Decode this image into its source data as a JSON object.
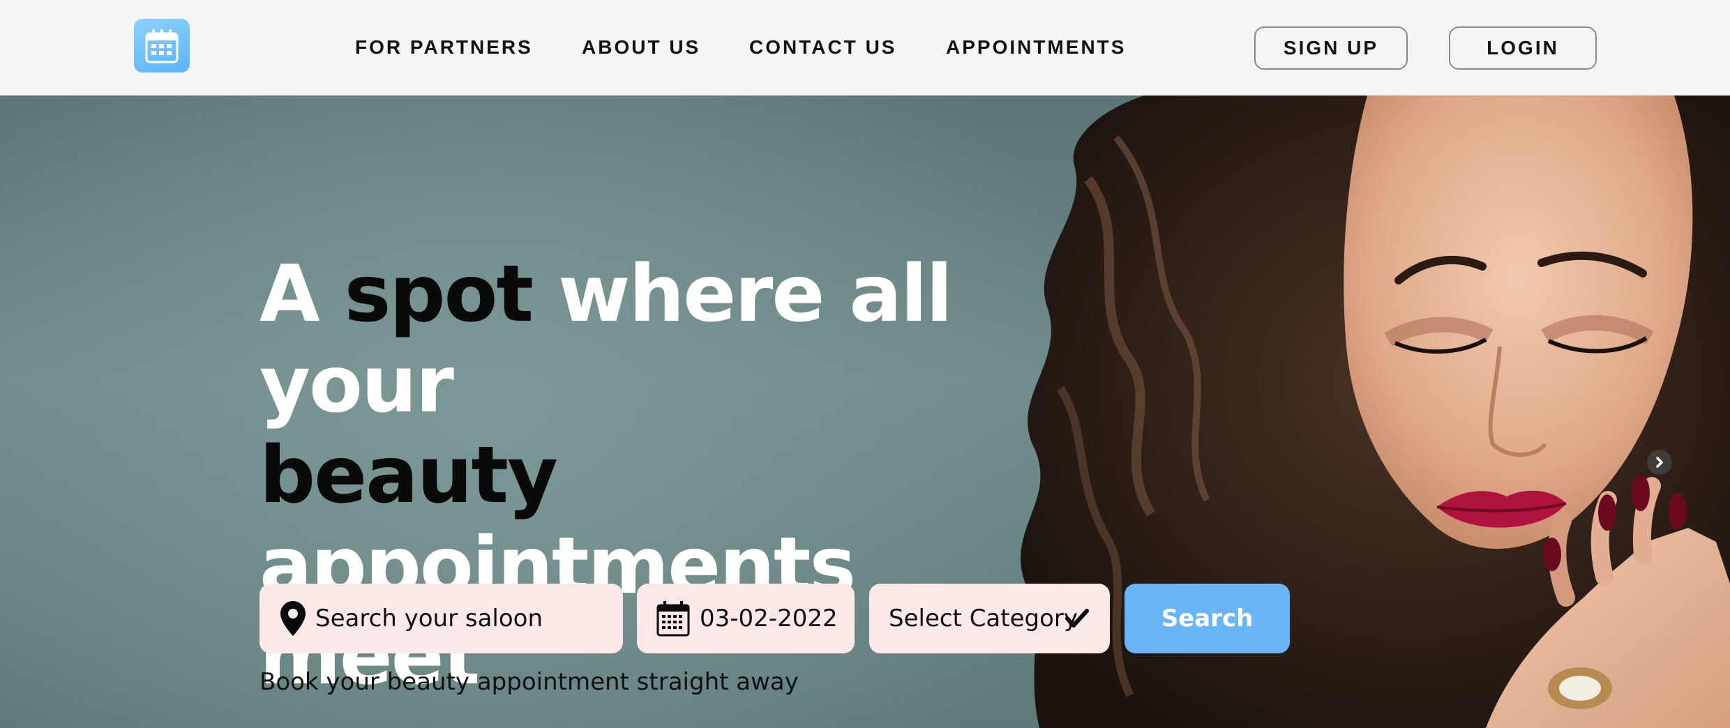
{
  "header": {
    "logo_icon": "calendar-logo-icon",
    "nav": [
      {
        "label": "FOR PARTNERS"
      },
      {
        "label": "ABOUT US"
      },
      {
        "label": "CONTACT US"
      },
      {
        "label": "APPOINTMENTS"
      }
    ],
    "signup_label": "SIGN UP",
    "login_label": "LOGIN"
  },
  "hero": {
    "headline": {
      "line1": [
        "A",
        "spot",
        "where all your"
      ],
      "line2": [
        "beauty",
        "appointments"
      ],
      "line3": [
        "meet"
      ]
    },
    "search": {
      "location_placeholder": "Search your saloon",
      "location_icon": "map-pin-icon",
      "date_value": "03-02-2022",
      "date_icon": "calendar-icon",
      "category_value": "Select Category",
      "category_icon": "checkmark-icon",
      "button_label": "Search"
    },
    "tagline": "Book your beauty appointment straight away",
    "carousel_next_icon": "chevron-right-icon"
  },
  "colors": {
    "accent": "#69b5f8",
    "field_bg": "#fde8e8",
    "header_bg": "#f5f5f5",
    "hero_bg": "#6f8b8a"
  }
}
